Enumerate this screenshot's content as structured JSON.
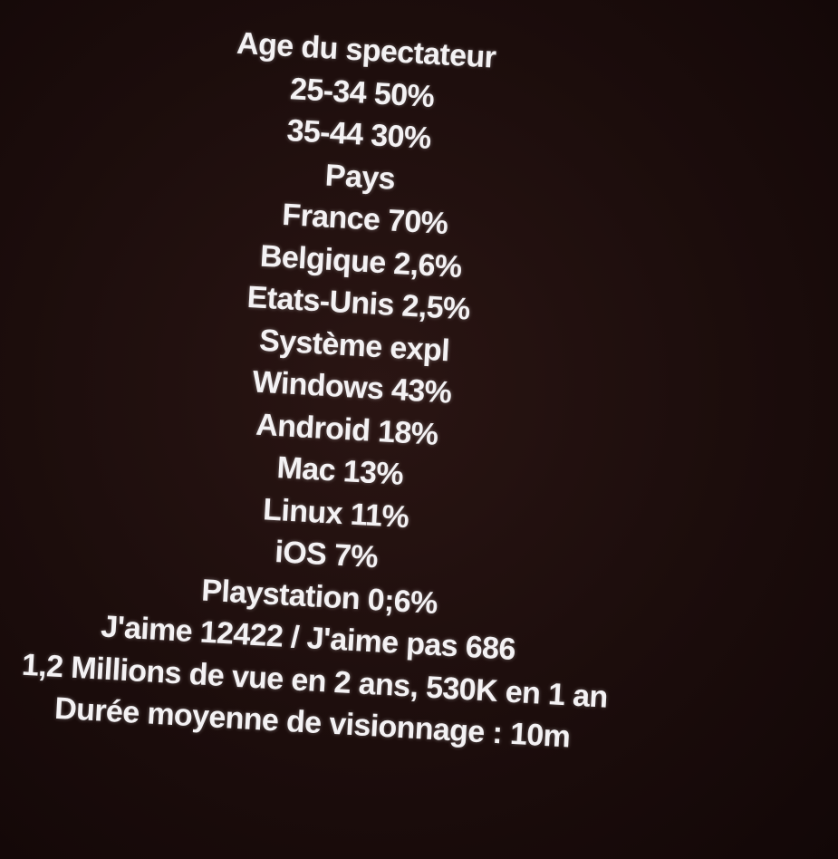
{
  "lines": [
    "Age du spectateur",
    "25-34 50%",
    "35-44 30%",
    "Pays",
    "France 70%",
    "Belgique 2,6%",
    "Etats-Unis 2,5%",
    "Système expl",
    "Windows 43%",
    "Android 18%",
    "Mac 13%",
    "Linux 11%",
    "iOS 7%",
    "Playstation 0;6%",
    "J'aime 12422 / J'aime pas 686",
    "1,2 Millions de vue en 2 ans, 530K en 1 an",
    "Durée moyenne de visionnage : 10m"
  ]
}
